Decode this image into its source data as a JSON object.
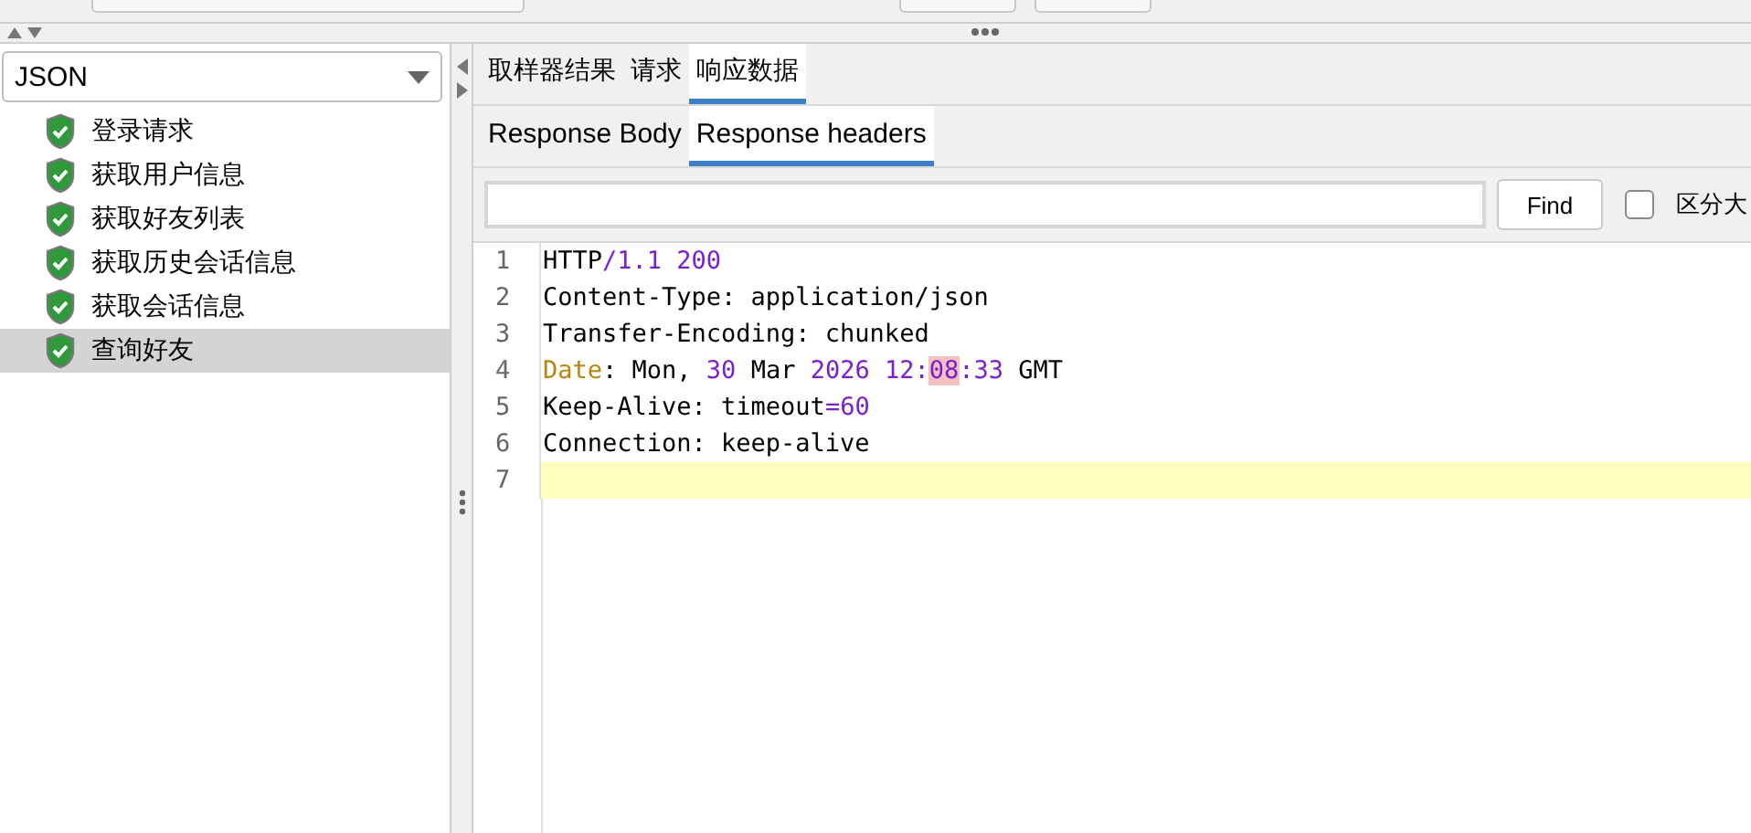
{
  "renderer": {
    "value": "JSON"
  },
  "samplers": [
    {
      "label": "登录请求",
      "passed": true,
      "selected": false
    },
    {
      "label": "获取用户信息",
      "passed": true,
      "selected": false
    },
    {
      "label": "获取好友列表",
      "passed": true,
      "selected": false
    },
    {
      "label": "获取历史会话信息",
      "passed": true,
      "selected": false
    },
    {
      "label": "获取会话信息",
      "passed": true,
      "selected": false
    },
    {
      "label": "查询好友",
      "passed": true,
      "selected": true
    }
  ],
  "tabs": [
    {
      "label": "取样器结果",
      "selected": false
    },
    {
      "label": "请求",
      "selected": false
    },
    {
      "label": "响应数据",
      "selected": true
    }
  ],
  "subtabs": [
    {
      "label": "Response Body",
      "selected": false
    },
    {
      "label": "Response headers",
      "selected": true
    }
  ],
  "search": {
    "button": "Find",
    "case_label": "区分大",
    "case_checked": false
  },
  "lines": [
    {
      "number": "1",
      "selected": false,
      "tokens": [
        {
          "kind": "plain",
          "text": "HTTP"
        },
        {
          "kind": "number",
          "text": "/1.1 200"
        }
      ]
    },
    {
      "number": "2",
      "selected": false,
      "tokens": [
        {
          "kind": "plain",
          "text": "Content-Type: application/json"
        }
      ]
    },
    {
      "number": "3",
      "selected": false,
      "tokens": [
        {
          "kind": "plain",
          "text": "Transfer-Encoding: chunked"
        }
      ]
    },
    {
      "number": "4",
      "selected": false,
      "tokens": [
        {
          "kind": "key",
          "text": "Date"
        },
        {
          "kind": "plain",
          "text": ": Mon, "
        },
        {
          "kind": "number",
          "text": "30"
        },
        {
          "kind": "plain",
          "text": " Mar "
        },
        {
          "kind": "number",
          "text": "2026 12:"
        },
        {
          "kind": "match",
          "text": "08"
        },
        {
          "kind": "number",
          "text": ":33"
        },
        {
          "kind": "plain",
          "text": " GMT"
        }
      ]
    },
    {
      "number": "5",
      "selected": false,
      "tokens": [
        {
          "kind": "plain",
          "text": "Keep-Alive: timeout"
        },
        {
          "kind": "number",
          "text": "=60"
        }
      ]
    },
    {
      "number": "6",
      "selected": false,
      "tokens": [
        {
          "kind": "plain",
          "text": "Connection: keep-alive"
        }
      ]
    },
    {
      "number": "7",
      "selected": true
    }
  ]
}
